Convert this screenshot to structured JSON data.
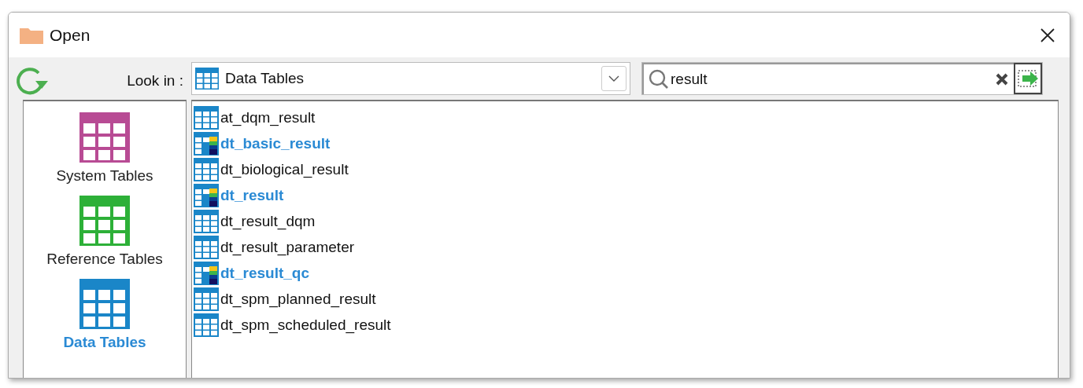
{
  "window": {
    "title": "Open"
  },
  "look_in": {
    "label": "Look in :",
    "value": "Data Tables"
  },
  "search": {
    "value": "result"
  },
  "sidebar": {
    "items": [
      {
        "label": "System Tables",
        "color": "#b84b94",
        "selected": false
      },
      {
        "label": "Reference Tables",
        "color": "#2db038",
        "selected": false
      },
      {
        "label": "Data Tables",
        "color": "#1a86c8",
        "selected": true
      }
    ]
  },
  "files": [
    {
      "name": "at_dqm_result",
      "kind": "table"
    },
    {
      "name": "dt_basic_result",
      "kind": "map"
    },
    {
      "name": "dt_biological_result",
      "kind": "table"
    },
    {
      "name": "dt_result",
      "kind": "map"
    },
    {
      "name": "dt_result_dqm",
      "kind": "table"
    },
    {
      "name": "dt_result_parameter",
      "kind": "table"
    },
    {
      "name": "dt_result_qc",
      "kind": "map"
    },
    {
      "name": "dt_spm_planned_result",
      "kind": "table"
    },
    {
      "name": "dt_spm_scheduled_result",
      "kind": "table"
    }
  ]
}
